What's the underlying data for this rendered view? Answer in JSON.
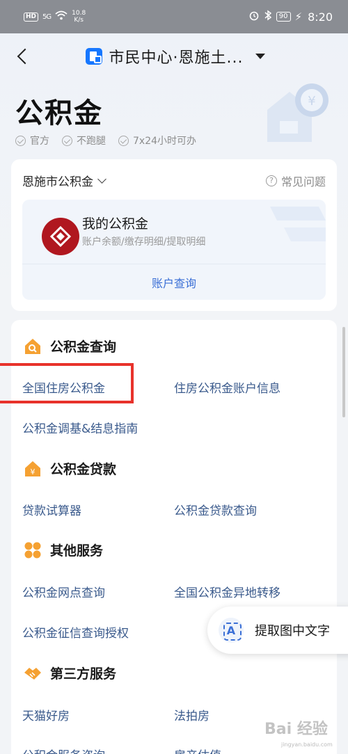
{
  "status_bar": {
    "hd": "HD",
    "signal": "5G",
    "speed": "10.8",
    "speed_unit": "K/s",
    "battery": "90",
    "time": "8:20"
  },
  "nav": {
    "title": "市民中心·恩施土..."
  },
  "hero": {
    "title": "公积金",
    "tags": [
      "官方",
      "不跑腿",
      "7x24小时可办"
    ]
  },
  "account_card": {
    "region": "恩施市公积金",
    "faq": "常见问题",
    "my_title": "我的公积金",
    "my_sub": "账户余额/缴存明细/提取明细",
    "query_button": "账户查询"
  },
  "sections": [
    {
      "title": "公积金查询",
      "items": [
        "全国住房公积金",
        "住房公积金账户信息",
        "公积金调基&结息指南"
      ]
    },
    {
      "title": "公积金贷款",
      "items": [
        "贷款试算器",
        "公积金贷款查询"
      ]
    },
    {
      "title": "其他服务",
      "items": [
        "公积金网点查询",
        "全国公积金异地转移",
        "公积金征信查询授权"
      ]
    },
    {
      "title": "第三方服务",
      "items": [
        "天猫好房",
        "法拍房",
        "公积金服务咨询",
        "房产估值"
      ]
    }
  ],
  "float": {
    "icon_letter": "A",
    "label": "提取图中文字"
  },
  "watermark": {
    "brand": "Bai 经验",
    "url": "jingyan.baidu.com"
  },
  "colors": {
    "accent": "#1677ff",
    "link": "#3a5a8c",
    "highlight": "#e8322b",
    "section_icon": "#f5a132",
    "logo_red": "#b0171f"
  }
}
